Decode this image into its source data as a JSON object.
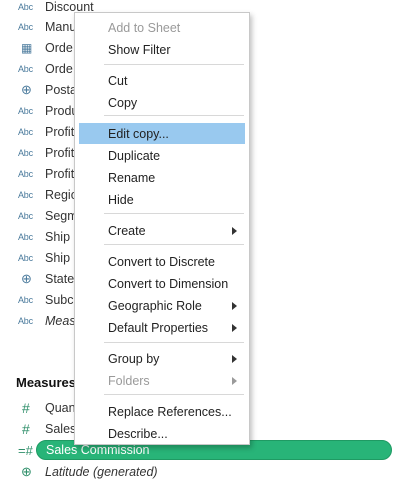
{
  "dimensions": [
    {
      "icon": "abc",
      "label": "Discount"
    },
    {
      "icon": "abc",
      "label": "Manu"
    },
    {
      "icon": "calendar",
      "label": "Orde"
    },
    {
      "icon": "abc",
      "label": "Orde"
    },
    {
      "icon": "globe",
      "label": "Posta"
    },
    {
      "icon": "abc",
      "label": "Produ"
    },
    {
      "icon": "abc",
      "label": "Profit"
    },
    {
      "icon": "abc",
      "label": "Profit"
    },
    {
      "icon": "abc",
      "label": "Profit"
    },
    {
      "icon": "abc",
      "label": "Regio"
    },
    {
      "icon": "abc",
      "label": "Segm"
    },
    {
      "icon": "abc",
      "label": "Ship"
    },
    {
      "icon": "abc",
      "label": "Ship"
    },
    {
      "icon": "globe",
      "label": "State"
    },
    {
      "icon": "abc",
      "label": "Subc"
    },
    {
      "icon": "abc",
      "label": "Meas",
      "italic": true
    }
  ],
  "icon_text": {
    "abc": "Abc",
    "hash": "#",
    "globe": "⊕",
    "calendar": "▦"
  },
  "measures": {
    "header": "Measures",
    "items": [
      {
        "icon": "hash",
        "label": "Quan"
      },
      {
        "icon": "hash",
        "label": "Sales"
      }
    ],
    "selected": {
      "icon": "hash",
      "label": "Sales Commission"
    },
    "last": {
      "icon": "globe",
      "label": "Latitude (generated)"
    }
  },
  "context_menu": {
    "highlight_color": "#99c9ef",
    "groups": [
      [
        {
          "label": "Add to Sheet",
          "disabled": true
        },
        {
          "label": "Show Filter"
        }
      ],
      [
        {
          "label": "Cut"
        },
        {
          "label": "Copy"
        }
      ],
      [
        {
          "label": "Edit copy...",
          "highlighted": true
        },
        {
          "label": "Duplicate"
        },
        {
          "label": "Rename"
        },
        {
          "label": "Hide"
        }
      ],
      [
        {
          "label": "Create",
          "submenu": true
        }
      ],
      [
        {
          "label": "Convert to Discrete"
        },
        {
          "label": "Convert to Dimension"
        },
        {
          "label": "Geographic Role",
          "submenu": true
        },
        {
          "label": "Default Properties",
          "submenu": true
        }
      ],
      [
        {
          "label": "Group by",
          "submenu": true
        },
        {
          "label": "Folders",
          "submenu": true,
          "disabled": true
        }
      ],
      [
        {
          "label": "Replace References..."
        },
        {
          "label": "Describe..."
        }
      ]
    ]
  },
  "colors": {
    "measure_green": "#28b478",
    "dimension_blue": "#4a7a9c"
  }
}
